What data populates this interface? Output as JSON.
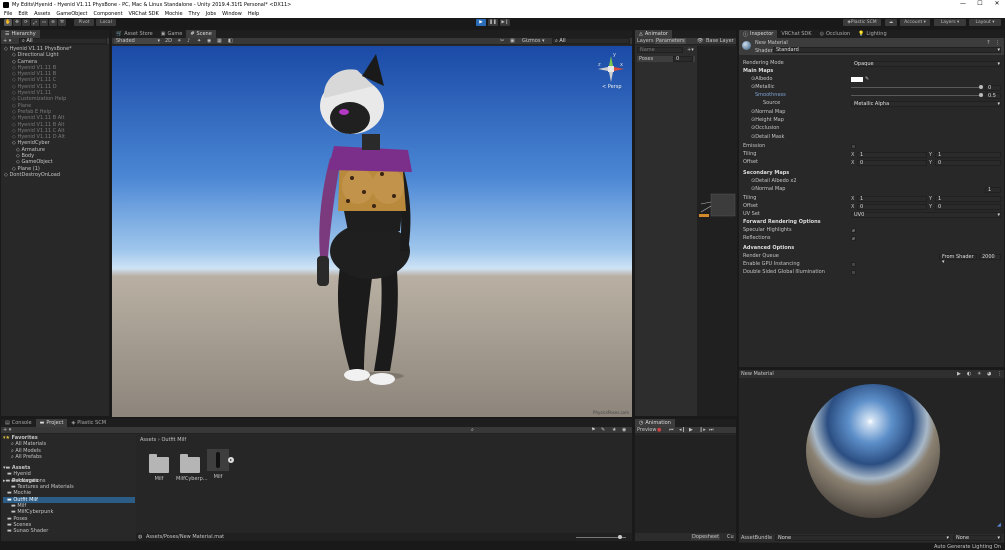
{
  "titlebar": {
    "title": "My Edits\\Hyenid - Hyenid V1.11 PhysBone - PC, Mac & Linux Standalone - Unity 2019.4.31f1 Personal* <DX11>",
    "minimize": "—",
    "maximize": "☐",
    "close": "✕"
  },
  "menubar": {
    "items": [
      "File",
      "Edit",
      "Assets",
      "GameObject",
      "Component",
      "VRChat SDK",
      "Mochie",
      "Thry",
      "Jobs",
      "Window",
      "Help"
    ]
  },
  "toolbar": {
    "pivot": "Pivot",
    "local": "Local",
    "play": "▶",
    "pause": "❚❚",
    "step": "▶❙",
    "plastic": "Plastic SCM",
    "account": "Account",
    "layers": "Layers",
    "layout": "Layout"
  },
  "hierarchy": {
    "tab": "Hierarchy",
    "search": "All",
    "items": [
      {
        "label": "Hyenid V1.11 PhysBone*",
        "indent": 0,
        "cls": ""
      },
      {
        "label": "Directional Light",
        "indent": 2,
        "cls": ""
      },
      {
        "label": "Camera",
        "indent": 2,
        "cls": ""
      },
      {
        "label": "Hyenid V1.11 B",
        "indent": 2,
        "cls": "dim"
      },
      {
        "label": "Hyenid V1.11 B",
        "indent": 2,
        "cls": "dim"
      },
      {
        "label": "Hyenid V1.11 C",
        "indent": 2,
        "cls": "dim"
      },
      {
        "label": "Hyenid V1.11 D",
        "indent": 2,
        "cls": "dim"
      },
      {
        "label": "Hyenid V1.11",
        "indent": 2,
        "cls": "dim"
      },
      {
        "label": "Customization Help",
        "indent": 2,
        "cls": "dim"
      },
      {
        "label": "Plane",
        "indent": 2,
        "cls": "dim"
      },
      {
        "label": "Prefab E Help",
        "indent": 2,
        "cls": "dim"
      },
      {
        "label": "Hyenid V1.11 B Alt",
        "indent": 2,
        "cls": "dim"
      },
      {
        "label": "Hyenid V1.11 B Alt",
        "indent": 2,
        "cls": "dim"
      },
      {
        "label": "Hyenid V1.11 C Alt",
        "indent": 2,
        "cls": "dim"
      },
      {
        "label": "Hyenid V1.11 D Alt",
        "indent": 2,
        "cls": "dim"
      },
      {
        "label": "HyenidCyber",
        "indent": 2,
        "cls": ""
      },
      {
        "label": "Armature",
        "indent": 3,
        "cls": ""
      },
      {
        "label": "Body",
        "indent": 3,
        "cls": ""
      },
      {
        "label": "GameObject",
        "indent": 3,
        "cls": ""
      },
      {
        "label": "Plane (1)",
        "indent": 2,
        "cls": ""
      },
      {
        "label": "DontDestroyOnLoad",
        "indent": 0,
        "cls": ""
      }
    ]
  },
  "scene": {
    "tabs": [
      "Asset Store",
      "Game",
      "Scene"
    ],
    "shading": "Shaded",
    "mode2d": "2D",
    "gizmos": "Gizmos",
    "search": "All",
    "persp": "< Persp",
    "axis_y": "y",
    "axis_x": "x",
    "axis_z": "z",
    "footer": "PhysicsPoses.com"
  },
  "animator": {
    "tab": "Animator",
    "layers": "Layers",
    "parameters": "Parameters",
    "base_layer": "Base Layer",
    "search": "Name",
    "param_name": "Poses",
    "param_value": "0"
  },
  "inspector": {
    "tabs": [
      "Inspector",
      "VRChat SDK",
      "Occlusion",
      "Lighting"
    ],
    "material_name": "New Material",
    "shader_label": "Shader",
    "shader_value": "Standard",
    "rendering_mode_label": "Rendering Mode",
    "rendering_mode_value": "Opaque",
    "main_maps": "Main Maps",
    "albedo": "Albedo",
    "metallic": "Metallic",
    "metallic_value": "0",
    "smoothness": "Smoothness",
    "smoothness_value": "0.5",
    "source": "Source",
    "source_value": "Metallic Alpha",
    "normal_map": "Normal Map",
    "height_map": "Height Map",
    "occlusion": "Occlusion",
    "detail_mask": "Detail Mask",
    "emission": "Emission",
    "tiling": "Tiling",
    "offset": "Offset",
    "tiling_x": "1",
    "tiling_y": "1",
    "offset_x": "0",
    "offset_y": "0",
    "secondary_maps": "Secondary Maps",
    "detail_albedo": "Detail Albedo x2",
    "detail_normal": "Normal Map",
    "detail_normal_value": "1",
    "tiling2_x": "1",
    "tiling2_y": "1",
    "offset2_x": "0",
    "offset2_y": "0",
    "uv_set": "UV Set",
    "uv_set_value": "UV0",
    "forward_options": "Forward Rendering Options",
    "specular": "Specular Highlights",
    "reflections": "Reflections",
    "advanced": "Advanced Options",
    "render_queue": "Render Queue",
    "render_queue_mode": "From Shader",
    "render_queue_value": "2000",
    "gpu_instancing": "Enable GPU Instancing",
    "double_sided": "Double Sided Global Illumination",
    "preview_title": "New Material",
    "assetbundle_label": "AssetBundle",
    "assetbundle_value": "None",
    "assetbundle_variant": "None",
    "auto_lighting": "Auto Generate Lighting On"
  },
  "project": {
    "tabs": [
      "Console",
      "Project",
      "Plastic SCM"
    ],
    "favorites": "Favorites",
    "fav_items": [
      "All Materials",
      "All Models",
      "All Prefabs"
    ],
    "assets": "Assets",
    "tree": [
      {
        "label": "Hyenid",
        "indent": 1,
        "cls": ""
      },
      {
        "label": "Animations",
        "indent": 2,
        "cls": ""
      },
      {
        "label": "Textures and Materials",
        "indent": 2,
        "cls": ""
      },
      {
        "label": "Mochie",
        "indent": 1,
        "cls": ""
      },
      {
        "label": "Outfit Milf",
        "indent": 1,
        "cls": "sel"
      },
      {
        "label": "Milf",
        "indent": 2,
        "cls": ""
      },
      {
        "label": "MilfCyberpunk",
        "indent": 2,
        "cls": ""
      },
      {
        "label": "Poses",
        "indent": 1,
        "cls": ""
      },
      {
        "label": "Scenes",
        "indent": 1,
        "cls": ""
      },
      {
        "label": "Sunao Shader",
        "indent": 1,
        "cls": ""
      }
    ],
    "packages": "Packages",
    "breadcrumb_root": "Assets",
    "breadcrumb_sep": "›",
    "breadcrumb_folder": "Outfit Milf",
    "grid": [
      {
        "label": "Milf",
        "kind": "folder"
      },
      {
        "label": "MilfCyberp...",
        "kind": "folder"
      },
      {
        "label": "Milf",
        "kind": "prefab"
      }
    ],
    "footer_path": "Assets/Poses/New Material.mat"
  },
  "animation": {
    "tab": "Animation",
    "preview": "Preview",
    "dopesheet": "Dopesheet",
    "curves": "Cu"
  },
  "colors": {
    "accent": "#2c5d87",
    "play": "#2a6cb8",
    "bg": "#191919"
  }
}
